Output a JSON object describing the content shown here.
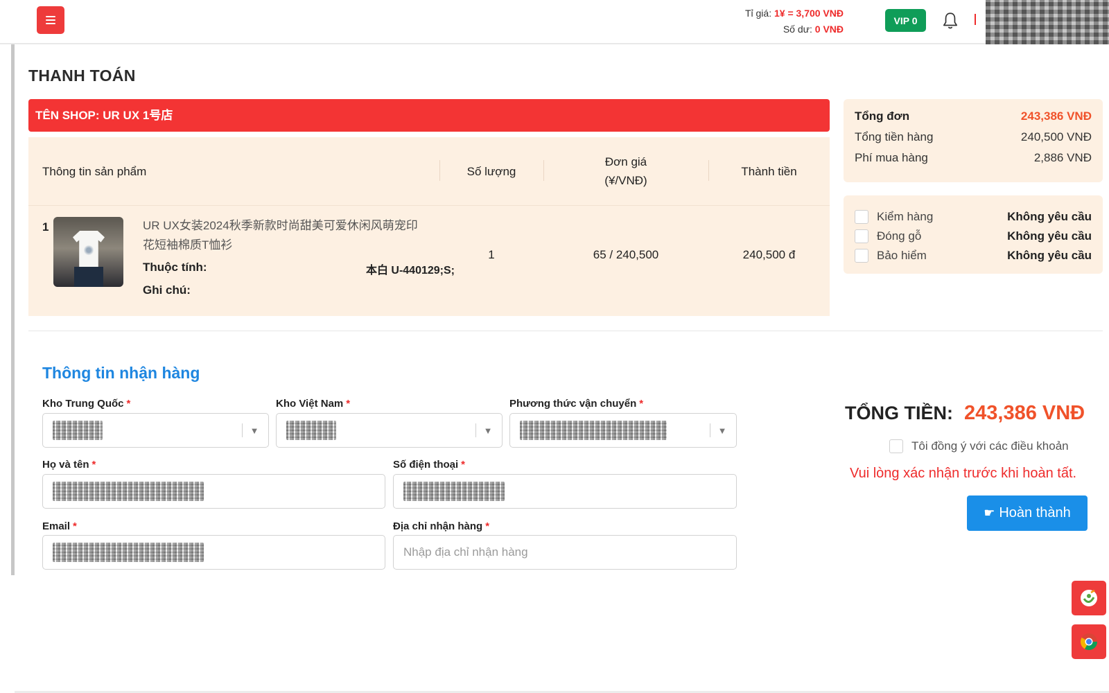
{
  "header": {
    "rate_label": "Tỉ giá:",
    "rate_value": "1¥ = 3,700 VNĐ",
    "balance_label": "Số dư:",
    "balance_value": "0 VNĐ",
    "vip_badge": "VIP 0"
  },
  "page": {
    "title": "THANH TOÁN"
  },
  "shop": {
    "name": "TÊN SHOP: UR UX 1号店"
  },
  "table": {
    "headers": {
      "product": "Thông tin sản phẩm",
      "quantity": "Số lượng",
      "price": "Đơn giá\n(¥/VNĐ)",
      "subtotal": "Thành tiền"
    },
    "rows": [
      {
        "index": "1",
        "name": "UR UX女装2024秋季新款时尚甜美可爱休闲风萌宠印花短袖棉质T恤衫",
        "attr_label": "Thuộc tính:",
        "attr_value": "本白 U-440129;S;",
        "note_label": "Ghi chú:",
        "quantity": "1",
        "price": "65 / 240,500",
        "subtotal": "240,500 đ"
      }
    ]
  },
  "summary": {
    "total_label": "Tổng đơn",
    "total_value": "243,386 VNĐ",
    "goods_label": "Tổng tiền hàng",
    "goods_value": "240,500 VNĐ",
    "fee_label": "Phí mua hàng",
    "fee_value": "2,886 VNĐ"
  },
  "services": [
    {
      "label": "Kiểm hàng",
      "value": "Không yêu cầu"
    },
    {
      "label": "Đóng gỗ",
      "value": "Không yêu cầu"
    },
    {
      "label": "Bảo hiểm",
      "value": "Không yêu cầu"
    }
  ],
  "form": {
    "section_title": "Thông tin nhận hàng",
    "china_warehouse_label": "Kho Trung Quốc",
    "vn_warehouse_label": "Kho Việt Nam",
    "shipping_label": "Phương thức vận chuyển",
    "name_label": "Họ và tên",
    "phone_label": "Số điện thoại",
    "email_label": "Email",
    "address_label": "Địa chỉ nhận hàng",
    "address_placeholder": "Nhập địa chỉ nhận hàng",
    "required_mark": "*"
  },
  "checkout": {
    "grand_total_label": "TỔNG TIỀN:",
    "grand_total_value": "243,386 VNĐ",
    "agree_label": "Tôi đồng ý với các điều khoản",
    "warning": "Vui lòng xác nhận trước khi hoàn tất.",
    "finish_label": "Hoàn thành"
  },
  "colors": {
    "brand_red": "#ee3b3b",
    "accent_orange": "#f0522a",
    "link_blue": "#1e86e0",
    "vip_green": "#0f9d58"
  }
}
